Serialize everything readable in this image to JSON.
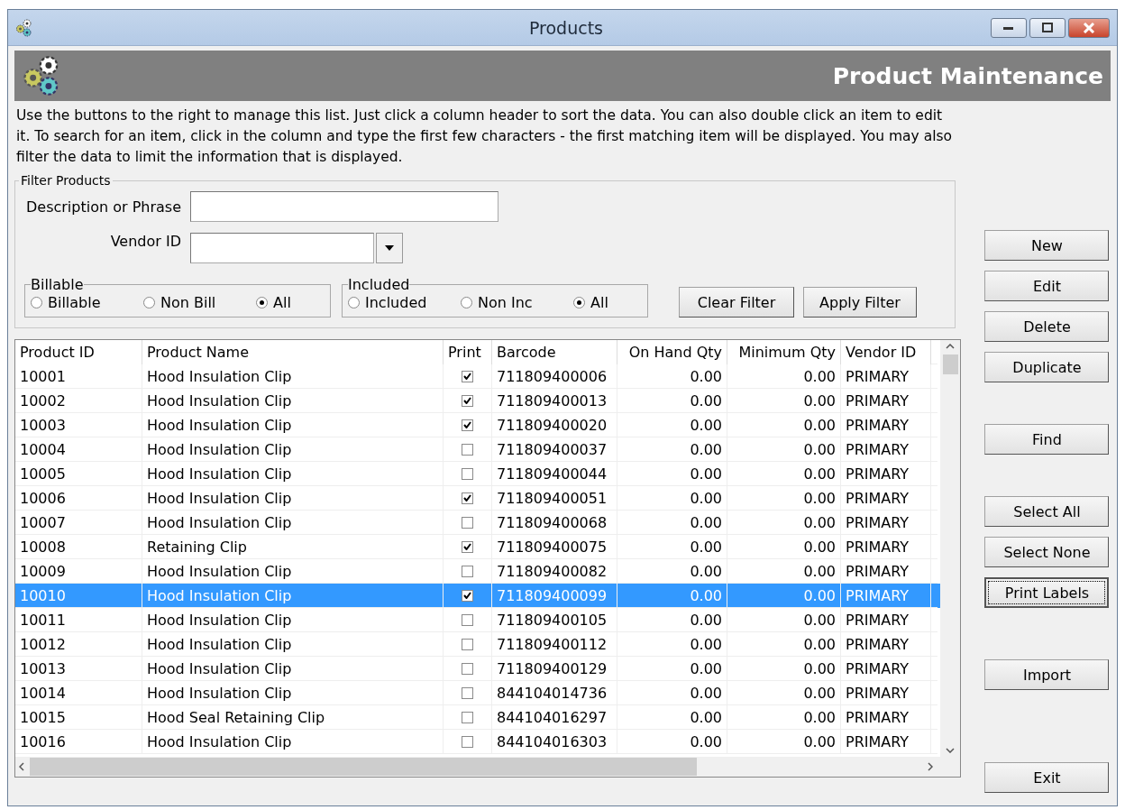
{
  "window": {
    "title": "Products"
  },
  "header": {
    "title": "Product Maintenance"
  },
  "intro": "Use the buttons to the right to manage this list.  Just click a column header to sort the data.  You can also double click an item to edit it.  To search for an item, click in the column and type the first few characters - the first matching item will be displayed.  You may also filter the data to limit the information that is displayed.",
  "filter": {
    "legend": "Filter Products",
    "description_label": "Description or Phrase",
    "vendor_label": "Vendor ID",
    "groups": [
      {
        "legend": "Billable",
        "options": [
          {
            "label": "Billable",
            "selected": false
          },
          {
            "label": "Non Bill",
            "selected": false
          },
          {
            "label": "All",
            "selected": true
          }
        ]
      },
      {
        "legend": "Included",
        "options": [
          {
            "label": "Included",
            "selected": false
          },
          {
            "label": "Non Inc",
            "selected": false
          },
          {
            "label": "All",
            "selected": true
          }
        ]
      }
    ],
    "buttons": [
      {
        "label": "Clear Filter"
      },
      {
        "label": "Apply Filter"
      }
    ]
  },
  "table": {
    "columns": [
      "Product ID",
      "Product Name",
      "Print",
      "Barcode",
      "On Hand Qty",
      "Minimum Qty",
      "Vendor ID"
    ],
    "rows": [
      {
        "id": "10001",
        "name": "Hood Insulation Clip",
        "print": true,
        "barcode": "711809400006",
        "on_hand": "0.00",
        "minimum": "0.00",
        "vendor": "PRIMARY",
        "selected": false
      },
      {
        "id": "10002",
        "name": "Hood Insulation Clip",
        "print": true,
        "barcode": "711809400013",
        "on_hand": "0.00",
        "minimum": "0.00",
        "vendor": "PRIMARY",
        "selected": false
      },
      {
        "id": "10003",
        "name": "Hood Insulation Clip",
        "print": true,
        "barcode": "711809400020",
        "on_hand": "0.00",
        "minimum": "0.00",
        "vendor": "PRIMARY",
        "selected": false
      },
      {
        "id": "10004",
        "name": "Hood Insulation Clip",
        "print": false,
        "barcode": "711809400037",
        "on_hand": "0.00",
        "minimum": "0.00",
        "vendor": "PRIMARY",
        "selected": false
      },
      {
        "id": "10005",
        "name": "Hood Insulation Clip",
        "print": false,
        "barcode": "711809400044",
        "on_hand": "0.00",
        "minimum": "0.00",
        "vendor": "PRIMARY",
        "selected": false
      },
      {
        "id": "10006",
        "name": "Hood Insulation Clip",
        "print": true,
        "barcode": "711809400051",
        "on_hand": "0.00",
        "minimum": "0.00",
        "vendor": "PRIMARY",
        "selected": false
      },
      {
        "id": "10007",
        "name": "Hood Insulation Clip",
        "print": false,
        "barcode": "711809400068",
        "on_hand": "0.00",
        "minimum": "0.00",
        "vendor": "PRIMARY",
        "selected": false
      },
      {
        "id": "10008",
        "name": "Retaining Clip",
        "print": true,
        "barcode": "711809400075",
        "on_hand": "0.00",
        "minimum": "0.00",
        "vendor": "PRIMARY",
        "selected": false
      },
      {
        "id": "10009",
        "name": "Hood Insulation Clip",
        "print": false,
        "barcode": "711809400082",
        "on_hand": "0.00",
        "minimum": "0.00",
        "vendor": "PRIMARY",
        "selected": false
      },
      {
        "id": "10010",
        "name": "Hood Insulation Clip",
        "print": true,
        "barcode": "711809400099",
        "on_hand": "0.00",
        "minimum": "0.00",
        "vendor": "PRIMARY",
        "selected": true
      },
      {
        "id": "10011",
        "name": "Hood Insulation Clip",
        "print": false,
        "barcode": "711809400105",
        "on_hand": "0.00",
        "minimum": "0.00",
        "vendor": "PRIMARY",
        "selected": false
      },
      {
        "id": "10012",
        "name": "Hood Insulation Clip",
        "print": false,
        "barcode": "711809400112",
        "on_hand": "0.00",
        "minimum": "0.00",
        "vendor": "PRIMARY",
        "selected": false
      },
      {
        "id": "10013",
        "name": "Hood Insulation Clip",
        "print": false,
        "barcode": "711809400129",
        "on_hand": "0.00",
        "minimum": "0.00",
        "vendor": "PRIMARY",
        "selected": false
      },
      {
        "id": "10014",
        "name": "Hood Insulation Clip",
        "print": false,
        "barcode": "844104014736",
        "on_hand": "0.00",
        "minimum": "0.00",
        "vendor": "PRIMARY",
        "selected": false
      },
      {
        "id": "10015",
        "name": "Hood Seal Retaining Clip",
        "print": false,
        "barcode": "844104016297",
        "on_hand": "0.00",
        "minimum": "0.00",
        "vendor": "PRIMARY",
        "selected": false
      },
      {
        "id": "10016",
        "name": "Hood Insulation Clip",
        "print": false,
        "barcode": "844104016303",
        "on_hand": "0.00",
        "minimum": "0.00",
        "vendor": "PRIMARY",
        "selected": false
      }
    ]
  },
  "action_groups": [
    [
      {
        "label": "New",
        "focused": false
      },
      {
        "label": "Edit",
        "focused": false
      },
      {
        "label": "Delete",
        "focused": false
      },
      {
        "label": "Duplicate",
        "focused": false
      }
    ],
    [
      {
        "label": "Find",
        "focused": false
      }
    ],
    [
      {
        "label": "Select All",
        "focused": false
      },
      {
        "label": "Select None",
        "focused": false
      },
      {
        "label": "Print Labels",
        "focused": true
      }
    ],
    [
      {
        "label": "Import",
        "focused": false
      }
    ],
    [
      {
        "label": "Exit",
        "focused": false
      }
    ]
  ]
}
